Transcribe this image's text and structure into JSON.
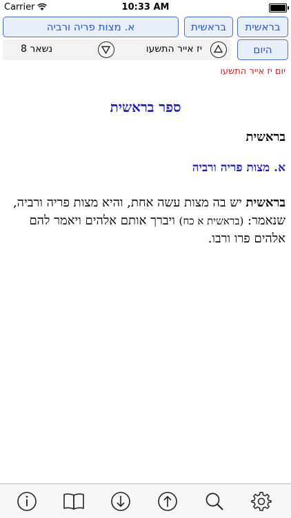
{
  "status_bar": {
    "carrier": "Carrier",
    "time": "10:33 AM"
  },
  "nav": {
    "book_label": "בראשית",
    "parsha_label": "בראשית",
    "mitzva_label": "א. מצות פריה ורביה",
    "today_label": "היום",
    "date": "יז אייר התשעו",
    "remaining": "נשאר 8"
  },
  "content": {
    "date_line": "יום יז אייר התשעו",
    "book_title": "ספר בראשית",
    "parsha_heading": "בראשית",
    "mitzva_heading": "א. מצות פריה ורביה",
    "body_lead": "בראשית",
    "body_text_1": " יש בה מצות עשה אחת, והיא מצות פריה ורביה, שנאמר: ",
    "body_ref": "(בראשית א כח)",
    "body_text_2": " ויברך אותם אלהים ויאמר להם אלהים פרו ורבו."
  },
  "tabs": [
    "info-icon",
    "book-icon",
    "arrow-down-icon",
    "arrow-up-icon",
    "search-icon",
    "gear-icon"
  ],
  "colors": {
    "accent": "#1f55d8",
    "title_blue": "#1717d8",
    "date_red": "#d02020"
  }
}
